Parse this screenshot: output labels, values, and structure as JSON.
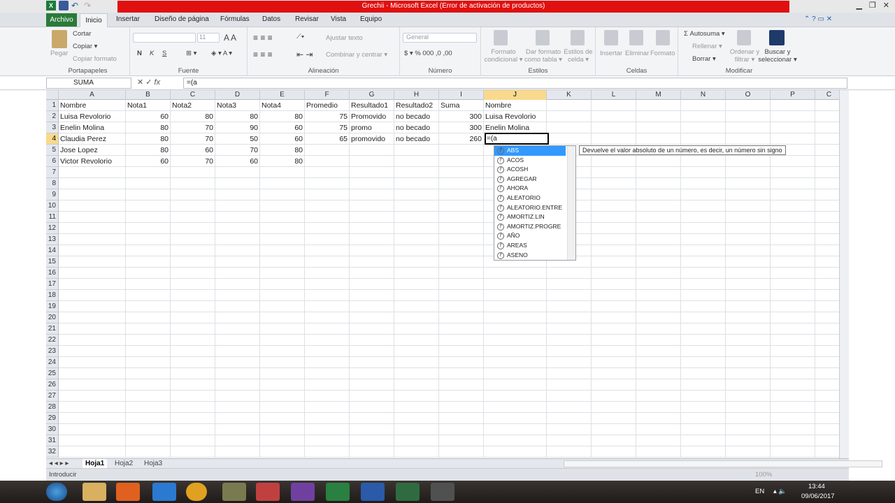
{
  "window": {
    "title": "Grechii - Microsoft Excel (Error de activación de productos)"
  },
  "tabs": {
    "file": "Archivo",
    "active": "Inicio",
    "others": [
      "Insertar",
      "Diseño de página",
      "Fórmulas",
      "Datos",
      "Revisar",
      "Vista",
      "Equipo"
    ]
  },
  "ribbon": {
    "clipboard": {
      "paste": "Pegar",
      "cut": "Cortar",
      "copy": "Copiar ▾",
      "format": "Copiar formato",
      "label": "Portapapeles"
    },
    "font": {
      "size": "11",
      "label": "Fuente",
      "bold": "N",
      "italic": "K",
      "underline": "S"
    },
    "alignment": {
      "wrap": "Ajustar texto",
      "merge": "Combinar y centrar ▾",
      "label": "Alineación"
    },
    "number": {
      "format": "General",
      "label": "Número"
    },
    "styles": {
      "cond": "Formato condicional ▾",
      "table": "Dar formato como tabla ▾",
      "cell": "Estilos de celda ▾",
      "label": "Estilos"
    },
    "cells": {
      "insert": "Insertar",
      "delete": "Eliminar",
      "format": "Formato",
      "label": "Celdas"
    },
    "editing": {
      "autosum": "Σ Autosuma ▾",
      "fill": "Rellenar ▾",
      "clear": "Borrar ▾",
      "sort": "Ordenar y filtrar ▾",
      "find": "Buscar y seleccionar ▾",
      "label": "Modificar"
    }
  },
  "formula_bar": {
    "name_box": "SUMA",
    "content": "=(a"
  },
  "columns": [
    "A",
    "B",
    "C",
    "D",
    "E",
    "F",
    "G",
    "H",
    "I",
    "J",
    "K",
    "L",
    "M",
    "N",
    "O",
    "P",
    "C"
  ],
  "rows": [
    [
      "Nombre",
      "Nota1",
      "Nota2",
      "Nota3",
      "Nota4",
      "Promedio",
      "Resultado1",
      "Resultado2",
      "Suma",
      "Nombre"
    ],
    [
      "Luisa Revolorio",
      "60",
      "80",
      "80",
      "80",
      "75",
      "Promovido",
      "no becado",
      "300",
      "Luisa Revolorio"
    ],
    [
      "Enelin Molina",
      "80",
      "70",
      "90",
      "60",
      "75",
      "promo",
      "no becado",
      "300",
      "Enelin Molina"
    ],
    [
      "Claudia Perez",
      "80",
      "70",
      "50",
      "60",
      "65",
      "promovido",
      "no becado",
      "260",
      ""
    ],
    [
      "Jose Lopez",
      "80",
      "60",
      "70",
      "80",
      "",
      "",
      "",
      "",
      ""
    ],
    [
      "Victor Revolorio",
      "60",
      "70",
      "60",
      "80",
      "",
      "",
      "",
      "",
      ""
    ]
  ],
  "active_cell": {
    "value": "=(a"
  },
  "autocomplete": {
    "items": [
      "ABS",
      "ACOS",
      "ACOSH",
      "AGREGAR",
      "AHORA",
      "ALEATORIO",
      "ALEATORIO.ENTRE",
      "AMORTIZ.LIN",
      "AMORTIZ.PROGRE",
      "AÑO",
      "AREAS",
      "ASENO"
    ],
    "selected": "ABS",
    "tooltip": "Devuelve el valor absoluto de un número, es decir, un número sin signo"
  },
  "sheets": [
    "Hoja1",
    "Hoja2",
    "Hoja3"
  ],
  "status": {
    "mode": "Introducir",
    "zoom": "100%"
  },
  "taskbar": {
    "lang": "EN",
    "time": "13:44",
    "date": "09/06/2017"
  },
  "colors": {
    "title_bar": "#e01010",
    "file_tab": "#2a7a3a",
    "selected_header": "#f9d98d",
    "selection": "#3399ff"
  }
}
